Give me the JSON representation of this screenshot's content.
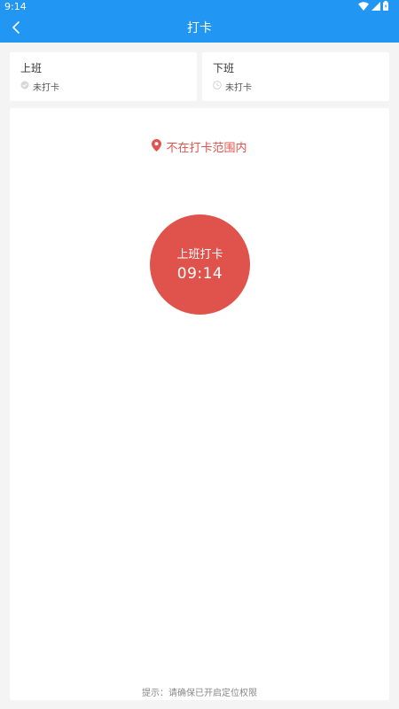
{
  "status_bar": {
    "time": "9:14",
    "icons": [
      "wifi-icon",
      "signal-icon",
      "battery-icon"
    ]
  },
  "app_bar": {
    "title": "打卡",
    "back_icon": "chevron-left-icon"
  },
  "shifts": [
    {
      "label": "上班",
      "status": "未打卡",
      "icon": "check-circle-icon"
    },
    {
      "label": "下班",
      "status": "未打卡",
      "icon": "clock-icon"
    }
  ],
  "main": {
    "range_warning": "不在打卡范围内",
    "range_icon": "location-pin-icon",
    "punch_button": {
      "label": "上班打卡",
      "time": "09:14"
    },
    "hint": "提示：请确保已开启定位权限"
  },
  "colors": {
    "primary": "#2196f3",
    "danger": "#e0534d",
    "background": "#f4f4f4",
    "card": "#ffffff"
  }
}
